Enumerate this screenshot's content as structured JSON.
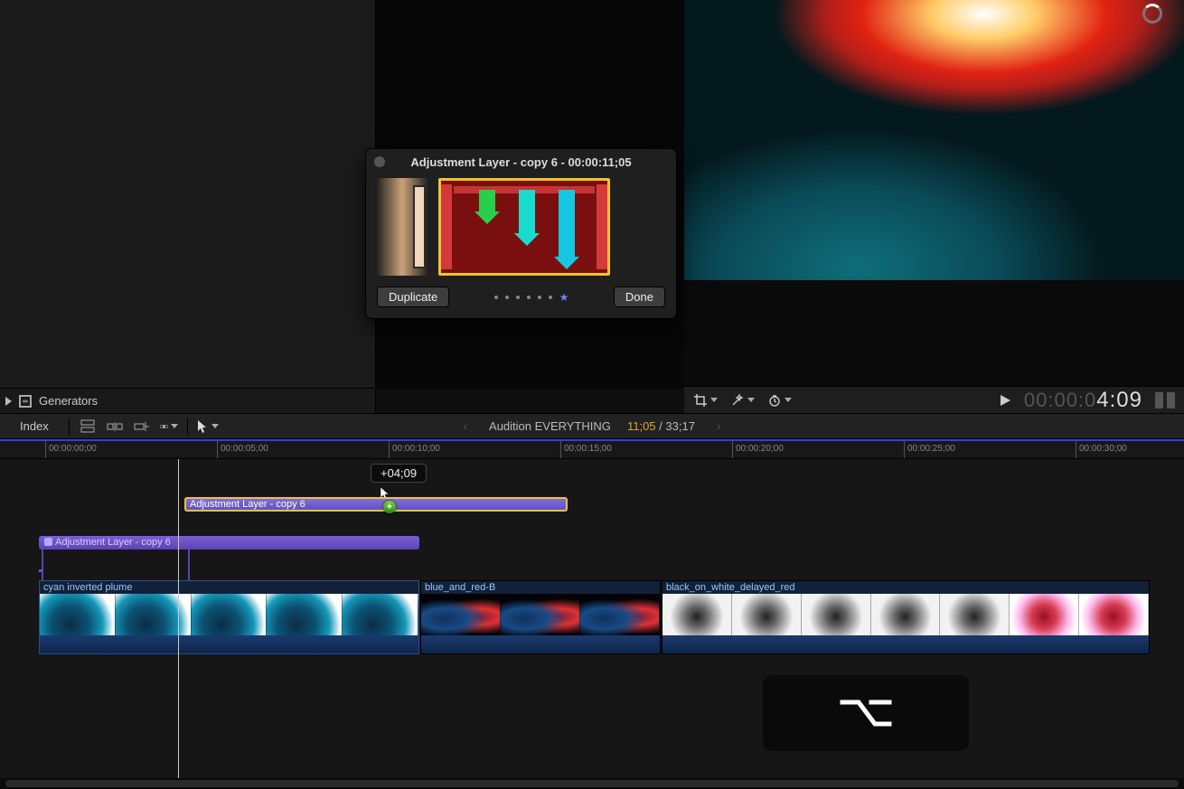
{
  "browser": {
    "generators_label": "Generators"
  },
  "viewer": {
    "timecode_gray": "00:00:0",
    "timecode_big": "4:09"
  },
  "audition_popover": {
    "title": "Adjustment Layer - copy 6 - 00:00:11;05",
    "duplicate_label": "Duplicate",
    "done_label": "Done",
    "dots_count": 7
  },
  "project": {
    "name": "Audition EVERYTHING",
    "playhead_tc": "11;05",
    "duration_tc": "33;17"
  },
  "toolbar": {
    "index_label": "Index"
  },
  "ruler": {
    "labels": [
      "00:00:00;00",
      "00:00:05;00",
      "00:00:10;00",
      "00:00:15;00",
      "00:00:20;00",
      "00:00:25;00",
      "00:00:30;00"
    ]
  },
  "drag": {
    "offset_label": "+04;09",
    "drag_clip_name": "Adjustment Layer - copy 6"
  },
  "connected_clip": {
    "name": "Adjustment Layer - copy 6"
  },
  "storyline": {
    "clips": [
      {
        "name": "cyan inverted plume"
      },
      {
        "name": "blue_and_red-B"
      },
      {
        "name": "black_on_white_delayed_red"
      }
    ]
  }
}
